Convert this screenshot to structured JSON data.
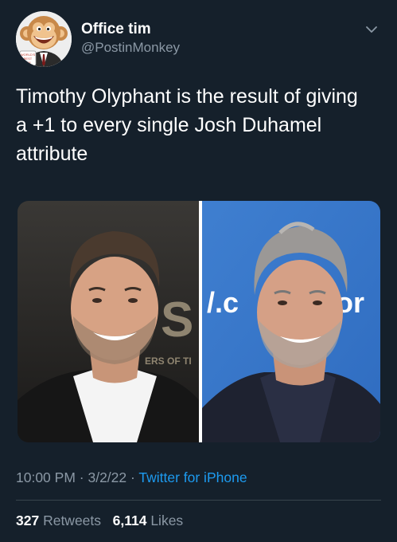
{
  "user": {
    "display_name": "Office tim",
    "handle": "@PostinMonkey",
    "avatar_badge": [
      "WORLD'S",
      "BEST",
      "TIM"
    ]
  },
  "tweet": {
    "text": "Timothy Olyphant is the result of giving a +1 to every single Josh Duhamel attribute"
  },
  "media": {
    "left_photo_backdrop_text": "ERS OF TI",
    "left_photo_big_letters": "S",
    "right_photo_backdrop_text_1": "/.c",
    "right_photo_backdrop_text_2": "or"
  },
  "meta": {
    "time": "10:00 PM",
    "separator": " · ",
    "date": "3/2/22",
    "source": "Twitter for iPhone"
  },
  "stats": {
    "retweets_count": "327",
    "retweets_label": "Retweets",
    "likes_count": "6,114",
    "likes_label": "Likes"
  },
  "colors": {
    "background": "#15202b",
    "secondary_text": "#8b98a5",
    "link": "#1d9bf0",
    "divider": "#38444d"
  },
  "icons": {
    "menu": "chevron-down-icon"
  }
}
